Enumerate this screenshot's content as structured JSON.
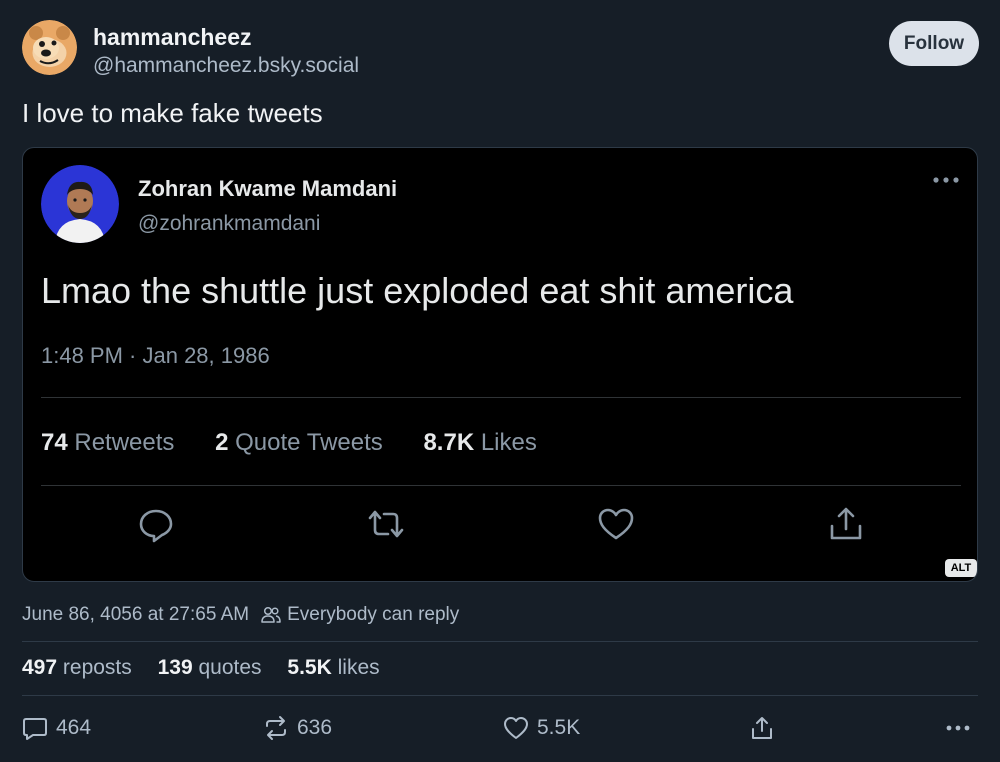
{
  "post": {
    "author_name": "hammancheez",
    "author_handle": "@hammancheez.bsky.social",
    "follow_label": "Follow",
    "text": "I love to make fake tweets",
    "timestamp": "June 86, 4056 at 27:65 AM",
    "reply_setting": "Everybody can reply",
    "counts": {
      "reposts_value": "497",
      "reposts_label": "reposts",
      "quotes_value": "139",
      "quotes_label": "quotes",
      "likes_value": "5.5K",
      "likes_label": "likes"
    },
    "actions": {
      "reply_count": "464",
      "repost_count": "636",
      "like_count": "5.5K"
    }
  },
  "embedded_tweet": {
    "name": "Zohran Kwame Mamdani",
    "handle": "@zohrankmamdani",
    "text": "Lmao the shuttle just exploded eat shit america",
    "time": "1:48 PM · Jan 28, 1986",
    "stats": {
      "retweets_value": "74",
      "retweets_label": "Retweets",
      "quotes_value": "2",
      "quotes_label": "Quote Tweets",
      "likes_value": "8.7K",
      "likes_label": "Likes"
    },
    "alt_badge": "ALT"
  },
  "icons": {
    "avatar": "bear-avatar-icon",
    "tweet_avatar": "person-avatar-icon",
    "reply": "speech-bubble-icon",
    "retweet": "retweet-icon",
    "like": "heart-icon",
    "share": "share-icon",
    "more": "ellipsis-icon",
    "people": "people-icon"
  },
  "colors": {
    "background": "#161e27",
    "embed_background": "#000000",
    "follow_button": "#dce2ea",
    "muted_text": "#aebbc9"
  }
}
